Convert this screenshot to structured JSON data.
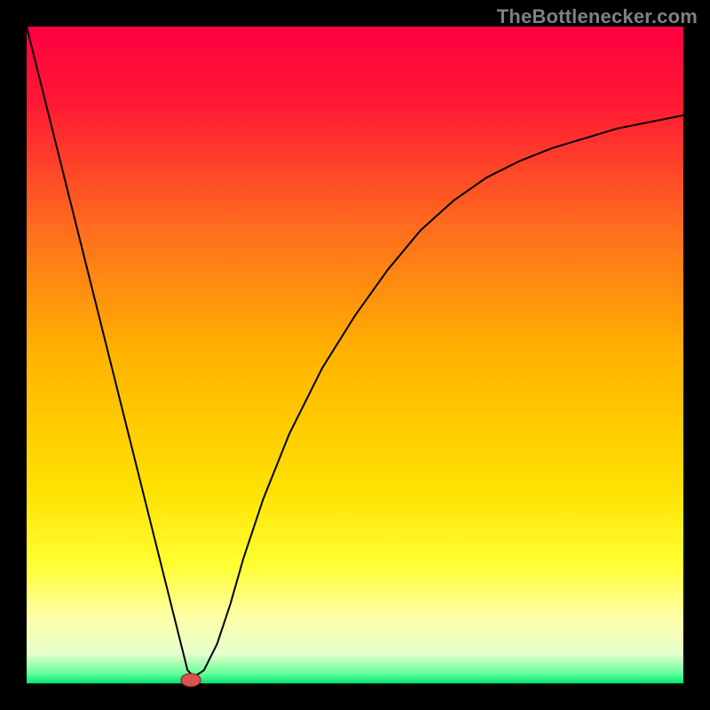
{
  "attribution": "TheBottlenecker.com",
  "chart_data": {
    "type": "line",
    "title": "",
    "xlabel": "",
    "ylabel": "",
    "xlim": [
      0,
      100
    ],
    "ylim": [
      0,
      100
    ],
    "legend": false,
    "background": {
      "type": "vertical-gradient",
      "stops": [
        {
          "offset": 0.0,
          "color": "#ff0040"
        },
        {
          "offset": 0.12,
          "color": "#ff1a33"
        },
        {
          "offset": 0.3,
          "color": "#ff6a1f"
        },
        {
          "offset": 0.5,
          "color": "#ffb300"
        },
        {
          "offset": 0.7,
          "color": "#ffe000"
        },
        {
          "offset": 0.82,
          "color": "#ffff33"
        },
        {
          "offset": 0.9,
          "color": "#ffffaa"
        },
        {
          "offset": 0.955,
          "color": "#e6ffcc"
        },
        {
          "offset": 0.985,
          "color": "#66ff99"
        },
        {
          "offset": 1.0,
          "color": "#00e57a"
        }
      ]
    },
    "series": [
      {
        "name": "bottleneck-curve",
        "color": "#000000",
        "width": 2,
        "x": [
          0,
          5,
          10,
          15,
          20,
          23,
          24,
          24.5,
          25.5,
          27,
          29,
          31,
          33,
          36,
          40,
          45,
          50,
          55,
          60,
          65,
          70,
          75,
          80,
          85,
          90,
          95,
          100
        ],
        "y": [
          100,
          80,
          60,
          40,
          20,
          8,
          4,
          2,
          1,
          2,
          6,
          12,
          19,
          28,
          38,
          48,
          56,
          63,
          69,
          73.5,
          77,
          79.5,
          81.5,
          83,
          84.5,
          85.5,
          86.5
        ]
      }
    ],
    "marker": {
      "name": "optimal-point",
      "x": 25,
      "y": 0.5,
      "rx": 1.5,
      "ry": 1.0,
      "fill": "#d9534f",
      "stroke": "#7a1f1f"
    }
  }
}
